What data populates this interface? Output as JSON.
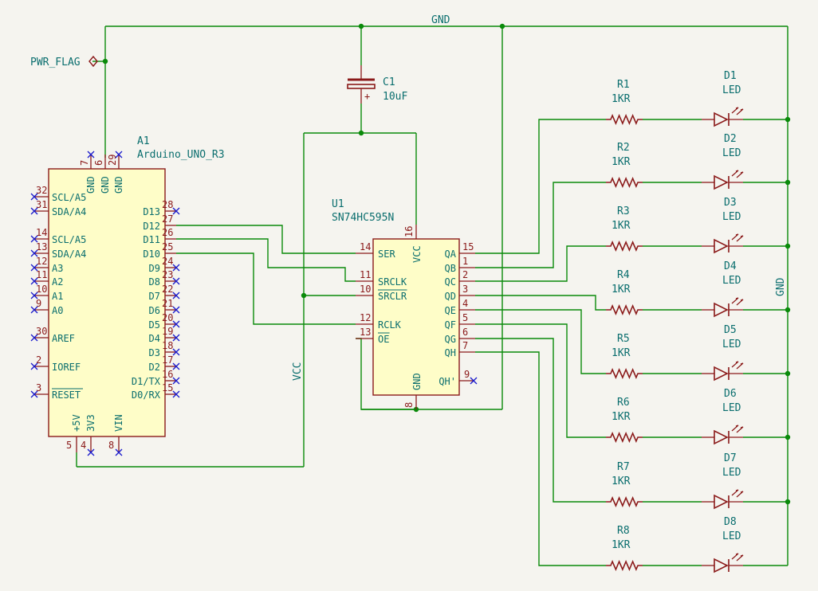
{
  "nets": {
    "gnd": "GND",
    "vcc": "VCC",
    "pwr_flag": "PWR_FLAG"
  },
  "capacitor": {
    "ref": "C1",
    "value": "10uF",
    "plus": "+"
  },
  "arduino": {
    "ref": "A1",
    "value": "Arduino_UNO_R3",
    "top_pins": [
      {
        "num": "7",
        "name": "GND"
      },
      {
        "num": "6",
        "name": "GND"
      },
      {
        "num": "29",
        "name": "GND"
      }
    ],
    "left_pins": [
      {
        "num": "32",
        "name": "SCL/A5"
      },
      {
        "num": "31",
        "name": "SDA/A4"
      },
      {
        "num": "14",
        "name": "SCL/A5"
      },
      {
        "num": "13",
        "name": "SDA/A4"
      },
      {
        "num": "12",
        "name": "A3"
      },
      {
        "num": "11",
        "name": "A2"
      },
      {
        "num": "10",
        "name": "A1"
      },
      {
        "num": "9",
        "name": "A0"
      },
      {
        "num": "30",
        "name": "AREF"
      },
      {
        "num": "2",
        "name": "IOREF"
      },
      {
        "num": "3",
        "name": "RESET"
      }
    ],
    "right_pins": [
      {
        "num": "28",
        "name": "D13"
      },
      {
        "num": "27",
        "name": "D12"
      },
      {
        "num": "26",
        "name": "D11"
      },
      {
        "num": "25",
        "name": "D10"
      },
      {
        "num": "24",
        "name": "D9"
      },
      {
        "num": "23",
        "name": "D8"
      },
      {
        "num": "22",
        "name": "D7"
      },
      {
        "num": "21",
        "name": "D6"
      },
      {
        "num": "20",
        "name": "D5"
      },
      {
        "num": "19",
        "name": "D4"
      },
      {
        "num": "18",
        "name": "D3"
      },
      {
        "num": "17",
        "name": "D2"
      },
      {
        "num": "16",
        "name": "D1/TX"
      },
      {
        "num": "15",
        "name": "D0/RX"
      }
    ],
    "bottom_pins": [
      {
        "num": "5",
        "name": "+5V"
      },
      {
        "num": "4",
        "name": "3V3"
      },
      {
        "num": "8",
        "name": "VIN"
      }
    ]
  },
  "shift_register": {
    "ref": "U1",
    "value": "SN74HC595N",
    "left_pins": [
      {
        "num": "14",
        "name": "SER"
      },
      {
        "num": "11",
        "name": "SRCLK"
      },
      {
        "num": "10",
        "name": "SRCLR"
      },
      {
        "num": "12",
        "name": "RCLK"
      },
      {
        "num": "13",
        "name": "OE"
      }
    ],
    "right_pins": [
      {
        "num": "15",
        "name": "QA"
      },
      {
        "num": "1",
        "name": "QB"
      },
      {
        "num": "2",
        "name": "QC"
      },
      {
        "num": "3",
        "name": "QD"
      },
      {
        "num": "4",
        "name": "QE"
      },
      {
        "num": "5",
        "name": "QF"
      },
      {
        "num": "6",
        "name": "QG"
      },
      {
        "num": "7",
        "name": "QH"
      }
    ],
    "vcc_pin": {
      "num": "16",
      "name": "VCC"
    },
    "gnd_pin": {
      "num": "8",
      "name": "GND"
    },
    "qh_prime_pin": {
      "num": "9",
      "name": "QH'"
    }
  },
  "resistors": [
    {
      "ref": "R1",
      "value": "1KR"
    },
    {
      "ref": "R2",
      "value": "1KR"
    },
    {
      "ref": "R3",
      "value": "1KR"
    },
    {
      "ref": "R4",
      "value": "1KR"
    },
    {
      "ref": "R5",
      "value": "1KR"
    },
    {
      "ref": "R6",
      "value": "1KR"
    },
    {
      "ref": "R7",
      "value": "1KR"
    },
    {
      "ref": "R8",
      "value": "1KR"
    }
  ],
  "leds": [
    {
      "ref": "D1",
      "value": "LED"
    },
    {
      "ref": "D2",
      "value": "LED"
    },
    {
      "ref": "D3",
      "value": "LED"
    },
    {
      "ref": "D4",
      "value": "LED"
    },
    {
      "ref": "D5",
      "value": "LED"
    },
    {
      "ref": "D6",
      "value": "LED"
    },
    {
      "ref": "D7",
      "value": "LED"
    },
    {
      "ref": "D8",
      "value": "LED"
    }
  ]
}
